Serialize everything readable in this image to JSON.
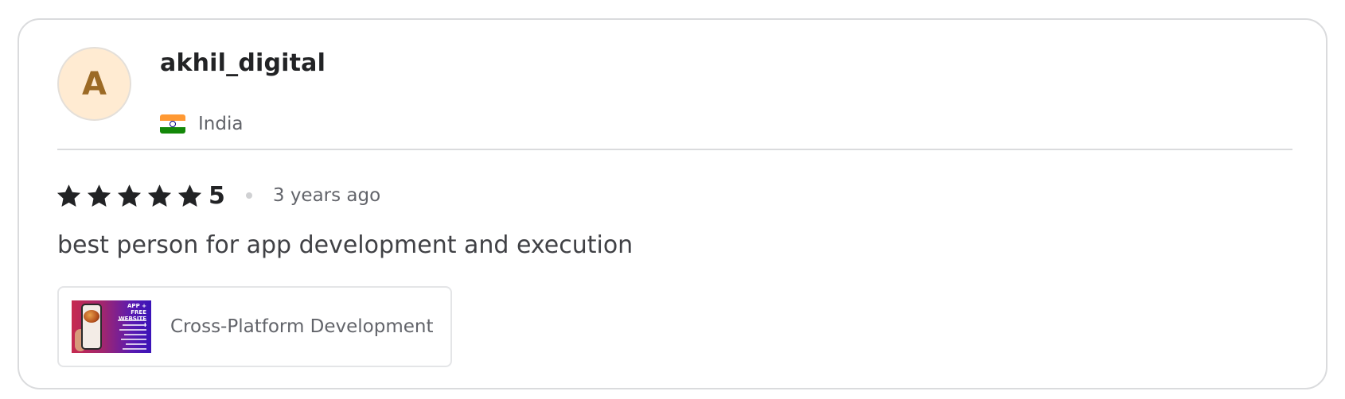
{
  "review": {
    "avatar_initial": "A",
    "username": "akhil_digital",
    "country": "India",
    "flag_icon": "india-flag-icon",
    "rating": "5",
    "stars_filled": 5,
    "stars_total": 5,
    "time_ago": "3 years ago",
    "text": "best person for app development and execution"
  },
  "gig": {
    "title": "Cross-Platform Development",
    "thumbnail_headline": "APP + FREE WEBSITE !"
  },
  "colors": {
    "avatar_bg": "#ffebd2",
    "avatar_text": "#9c6a25",
    "star": "#222325",
    "muted_text": "#62646a",
    "border": "#dadbdd"
  }
}
